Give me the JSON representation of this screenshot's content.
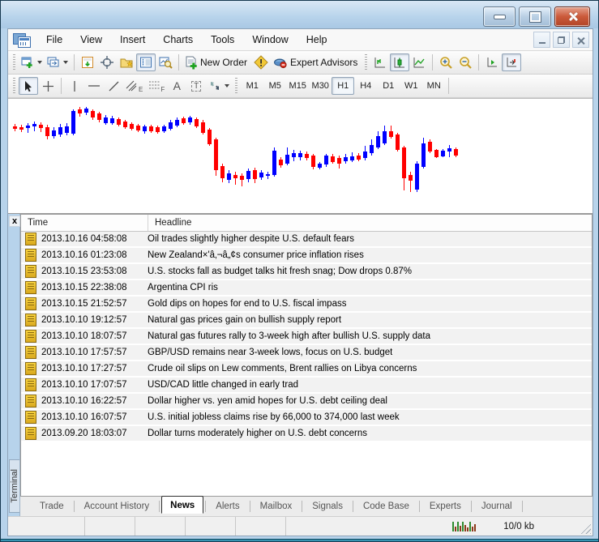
{
  "menu": {
    "items": [
      "File",
      "View",
      "Insert",
      "Charts",
      "Tools",
      "Window",
      "Help"
    ]
  },
  "toolbar": {
    "new_order_label": "New Order",
    "expert_advisors_label": "Expert Advisors",
    "icon_letters": {
      "channel": "E",
      "fibonacci": "F",
      "text": "A",
      "text_label": "T"
    }
  },
  "timeframes": {
    "items": [
      "M1",
      "M5",
      "M15",
      "M30",
      "H1",
      "H4",
      "D1",
      "W1",
      "MN"
    ],
    "active": "H1"
  },
  "chart_data": {
    "type": "candlestick",
    "timeframe": "H1",
    "up_color": "#0000ff",
    "down_color": "#ff0000",
    "background": "#ffffff",
    "units": "pixel offsets from chart top; candle = [direction, wick_top, body_top, body_bottom, wick_bottom]",
    "candles": [
      [
        "d",
        31,
        34,
        37,
        40
      ],
      [
        "d",
        32,
        35,
        38,
        41
      ],
      [
        "u",
        30,
        33,
        36,
        42
      ],
      [
        "u",
        28,
        31,
        34,
        40
      ],
      [
        "d",
        29,
        32,
        36,
        41
      ],
      [
        "d",
        32,
        35,
        46,
        50
      ],
      [
        "u",
        35,
        39,
        46,
        49
      ],
      [
        "u",
        31,
        35,
        44,
        47
      ],
      [
        "u",
        30,
        34,
        42,
        45
      ],
      [
        "u",
        13,
        15,
        43,
        45
      ],
      [
        "d",
        10,
        13,
        18,
        22
      ],
      [
        "u",
        10,
        12,
        17,
        20
      ],
      [
        "d",
        13,
        15,
        23,
        26
      ],
      [
        "d",
        16,
        18,
        26,
        29
      ],
      [
        "u",
        20,
        23,
        30,
        32
      ],
      [
        "u",
        21,
        24,
        30,
        32
      ],
      [
        "d",
        23,
        25,
        32,
        34
      ],
      [
        "d",
        26,
        28,
        35,
        37
      ],
      [
        "d",
        29,
        31,
        37,
        39
      ],
      [
        "d",
        31,
        33,
        39,
        41
      ],
      [
        "u",
        32,
        34,
        40,
        43
      ],
      [
        "d",
        32,
        34,
        40,
        42
      ],
      [
        "d",
        33,
        35,
        41,
        43
      ],
      [
        "u",
        32,
        34,
        40,
        42
      ],
      [
        "u",
        26,
        29,
        37,
        39
      ],
      [
        "u",
        23,
        26,
        33,
        35
      ],
      [
        "d",
        22,
        24,
        30,
        32
      ],
      [
        "u",
        21,
        23,
        29,
        32
      ],
      [
        "d",
        23,
        25,
        34,
        36
      ],
      [
        "d",
        26,
        29,
        42,
        44
      ],
      [
        "d",
        36,
        38,
        56,
        58
      ],
      [
        "d",
        48,
        50,
        88,
        95
      ],
      [
        "d",
        80,
        83,
        98,
        103
      ],
      [
        "u",
        88,
        92,
        100,
        104
      ],
      [
        "d",
        90,
        94,
        98,
        106
      ],
      [
        "d",
        92,
        95,
        100,
        108
      ],
      [
        "u",
        86,
        89,
        99,
        103
      ],
      [
        "d",
        85,
        88,
        99,
        104
      ],
      [
        "u",
        88,
        91,
        97,
        100
      ],
      [
        "u",
        90,
        93,
        95,
        99
      ],
      [
        "u",
        60,
        64,
        94,
        96
      ],
      [
        "d",
        72,
        75,
        82,
        85
      ],
      [
        "u",
        60,
        69,
        80,
        82
      ],
      [
        "u",
        63,
        67,
        72,
        77
      ],
      [
        "u",
        64,
        67,
        72,
        76
      ],
      [
        "d",
        65,
        68,
        73,
        76
      ],
      [
        "d",
        68,
        70,
        84,
        87
      ],
      [
        "u",
        78,
        80,
        85,
        87
      ],
      [
        "u",
        68,
        70,
        81,
        84
      ],
      [
        "d",
        68,
        71,
        78,
        80
      ],
      [
        "d",
        70,
        73,
        80,
        86
      ],
      [
        "u",
        68,
        72,
        77,
        80
      ],
      [
        "u",
        66,
        71,
        76,
        78
      ],
      [
        "d",
        67,
        70,
        75,
        77
      ],
      [
        "u",
        58,
        65,
        73,
        76
      ],
      [
        "u",
        50,
        57,
        67,
        70
      ],
      [
        "u",
        40,
        46,
        60,
        62
      ],
      [
        "u",
        33,
        40,
        55,
        57
      ],
      [
        "d",
        33,
        40,
        47,
        49
      ],
      [
        "d",
        42,
        44,
        63,
        65
      ],
      [
        "d",
        58,
        60,
        98,
        113
      ],
      [
        "d",
        90,
        94,
        101,
        115
      ],
      [
        "u",
        77,
        80,
        112,
        115
      ],
      [
        "u",
        48,
        55,
        84,
        86
      ],
      [
        "d",
        50,
        53,
        65,
        67
      ],
      [
        "d",
        62,
        63,
        72,
        73
      ],
      [
        "u",
        62,
        64,
        71,
        72
      ],
      [
        "u",
        57,
        61,
        65,
        72
      ],
      [
        "d",
        60,
        62,
        70,
        72
      ]
    ]
  },
  "terminal": {
    "side_label": "Terminal",
    "close_label": "x",
    "table": {
      "columns": [
        "Time",
        "Headline"
      ],
      "rows": [
        {
          "time": "2013.10.16 04:58:08",
          "headline": "Oil trades slightly higher despite U.S. default fears"
        },
        {
          "time": "2013.10.16 01:23:08",
          "headline": "New Zealand×'â‚¬â„¢s consumer price inflation rises"
        },
        {
          "time": "2013.10.15 23:53:08",
          "headline": "U.S. stocks fall as budget talks hit fresh snag; Dow drops 0.87%"
        },
        {
          "time": "2013.10.15 22:38:08",
          "headline": "Argentina CPI ris"
        },
        {
          "time": "2013.10.15 21:52:57",
          "headline": "Gold dips on hopes for end to U.S. fiscal impass"
        },
        {
          "time": "2013.10.10 19:12:57",
          "headline": "Natural gas prices gain on bullish supply report"
        },
        {
          "time": "2013.10.10 18:07:57",
          "headline": "Natural gas futures rally to 3-week high after bullish U.S. supply data"
        },
        {
          "time": "2013.10.10 17:57:57",
          "headline": "GBP/USD remains near 3-week lows, focus on U.S. budget"
        },
        {
          "time": "2013.10.10 17:27:57",
          "headline": "Crude oil slips on Lew comments, Brent rallies on Libya concerns"
        },
        {
          "time": "2013.10.10 17:07:57",
          "headline": "USD/CAD little changed in early trad"
        },
        {
          "time": "2013.10.10 16:22:57",
          "headline": "Dollar higher vs. yen amid hopes for U.S. debt ceiling deal"
        },
        {
          "time": "2013.10.10 16:07:57",
          "headline": "U.S. initial jobless claims rise by 66,000 to 374,000 last week"
        },
        {
          "time": "2013.09.20 18:03:07",
          "headline": "Dollar turns moderately higher on U.S. debt concerns"
        }
      ]
    },
    "tabs": {
      "items": [
        "Trade",
        "Account History",
        "News",
        "Alerts",
        "Mailbox",
        "Signals",
        "Code Base",
        "Experts",
        "Journal"
      ],
      "active": "News"
    }
  },
  "statusbar": {
    "traffic_label": "10/0 kb"
  },
  "colors": {
    "frame": "#b7d3eb",
    "up": "#0000ff",
    "down": "#ff0000",
    "news_icon": "#e8b820",
    "close_button": "#c0543c"
  }
}
